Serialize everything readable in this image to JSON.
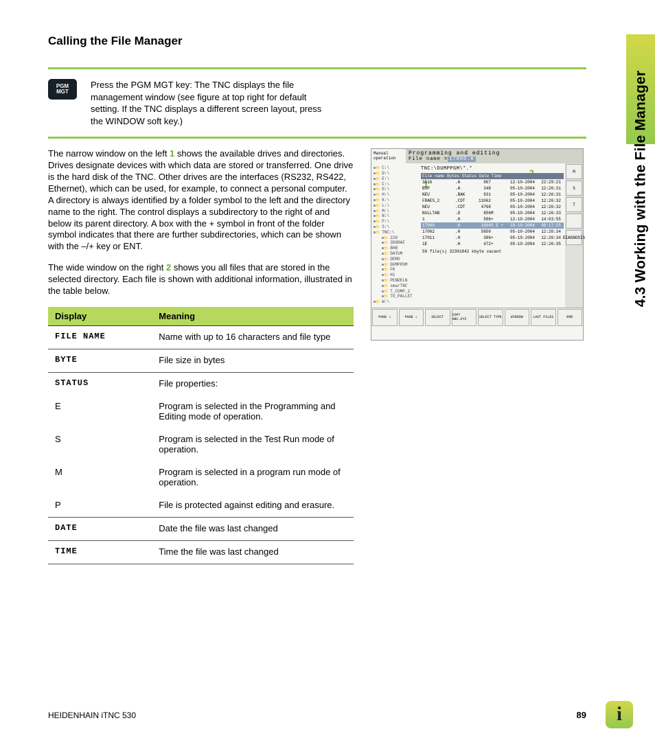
{
  "sideTab": "4.3 Working with the File Manager",
  "heading": "Calling the File Manager",
  "pgmKey": {
    "line1": "PGM",
    "line2": "MGT"
  },
  "introText": "Press the PGM MGT key: The TNC displays the file management window (see figure at top right for default setting. If the TNC displays a different screen layout, press the WINDOW soft key.)",
  "para1a": "The narrow window on the left ",
  "para1marker": "1",
  "para1b": " shows the available drives and directories. Drives designate devices with which data are stored or transferred. One drive is the hard disk of the TNC. Other drives are the interfaces (RS232, RS422, Ethernet), which can be used, for example, to connect a personal computer. A directory is always identified by a folder symbol to the left and the directory name to the right. The control displays a subdirectory to the right of and below its parent directory. A box with the + symbol in front of the folder symbol indicates that there are further subdirectories, which can be shown with the –/+ key or ENT.",
  "para2a": "The wide window on the right ",
  "para2marker": "2",
  "para2b": " shows you all files that are stored in the selected directory. Each file is shown with additional information, illustrated in the table below.",
  "tableHeader": {
    "c1": "Display",
    "c2": "Meaning"
  },
  "rows": [
    {
      "d": "FILE NAME",
      "mono": true,
      "m": "Name with up to 16 characters and file type",
      "border": true
    },
    {
      "d": "BYTE",
      "mono": true,
      "m": "File size in bytes",
      "border": true
    },
    {
      "d": "STATUS",
      "mono": true,
      "m": "File properties:",
      "border": false
    },
    {
      "d": "E",
      "mono": false,
      "m": "Program is selected in the Programming and Editing mode of operation.",
      "border": false
    },
    {
      "d": "S",
      "mono": false,
      "m": "Program is selected in the Test Run mode of operation.",
      "border": false
    },
    {
      "d": "M",
      "mono": false,
      "m": "Program is selected in a program run mode of operation.",
      "border": false
    },
    {
      "d": "P",
      "mono": false,
      "m": "File is protected against editing and erasure.",
      "border": true
    },
    {
      "d": "DATE",
      "mono": true,
      "m": "Date the file was last changed",
      "border": true
    },
    {
      "d": "TIME",
      "mono": true,
      "m": "Time the file was last changed",
      "border": true
    }
  ],
  "screenshot": {
    "mode": "Manual operation",
    "title": "Programming and editing",
    "fileLabel": "File name =",
    "fileName": "17000.H",
    "path": "TNC:\\DUMPPGM\\*.*",
    "headerRow": "File name            Bytes  Status Date      Time",
    "rows": [
      {
        "n": "3516",
        "e": ".A",
        "b": "967",
        "s": "",
        "d": "12-10-2004",
        "t": "22:29:21"
      },
      {
        "n": "BSP",
        "e": ".A",
        "b": "348",
        "s": "",
        "d": "05-10-2004",
        "t": "12:26:31"
      },
      {
        "n": "NEU",
        "e": ".BAK",
        "b": "931",
        "s": "",
        "d": "05-10-2004",
        "t": "12:26:31"
      },
      {
        "n": "FRAES_2",
        "e": ".CDT",
        "b": "11062",
        "s": "",
        "d": "05-10-2004",
        "t": "12:26:32"
      },
      {
        "n": "NEU",
        "e": ".CDT",
        "b": "4768",
        "s": "",
        "d": "05-10-2004",
        "t": "12:26:32"
      },
      {
        "n": "NULLTAB",
        "e": ".D",
        "b": "856",
        "s": "M",
        "d": "05-10-2004",
        "t": "12:26:33"
      },
      {
        "n": "1",
        "e": ".H",
        "b": "586",
        "s": "+",
        "d": "12-10-2004",
        "t": "14:03:55"
      },
      {
        "n": "17000",
        "e": ".H",
        "b": "1694",
        "s": "S E +",
        "d": "18-10-2004",
        "t": "08:17:25",
        "sel": true
      },
      {
        "n": "17002",
        "e": ".H",
        "b": "5650",
        "s": "",
        "d": "05-10-2004",
        "t": "12:26:34"
      },
      {
        "n": "17011",
        "e": ".H",
        "b": "386",
        "s": "+",
        "d": "05-10-2004",
        "t": "12:26:34"
      },
      {
        "n": "1E",
        "e": ".H",
        "b": "472",
        "s": "+",
        "d": "05-10-2004",
        "t": "12:26:35"
      }
    ],
    "summary": "50  file(s) 32301842 kbyte vacant",
    "drives": [
      "C:\\",
      "D:\\",
      "E:\\",
      "F:\\",
      "G:\\",
      "H:\\",
      "K:\\",
      "L:\\",
      "M:\\",
      "N:\\",
      "P:\\",
      "S:\\",
      "TNC:\\"
    ],
    "subdirs": [
      "220",
      "3DGRAF",
      "BHB",
      "DATUM",
      "DEMO",
      "DUMPPGM",
      "FK",
      "H1",
      "PENDELN",
      "smarTNC",
      "T_COMP_2",
      "TO_PALLET"
    ],
    "drives2": [
      "W:\\"
    ],
    "rightBtns": [
      "M",
      "S",
      "T",
      "",
      "DIAGNOSIS"
    ],
    "bottomBtns": [
      "PAGE ⇑",
      "PAGE ⇓",
      "SELECT",
      "COPY ABC→XYZ",
      "SELECT TYPE",
      "WINDOW",
      "LAST FILES",
      "END"
    ]
  },
  "footer": {
    "product": "HEIDENHAIN iTNC 530",
    "page": "89"
  }
}
